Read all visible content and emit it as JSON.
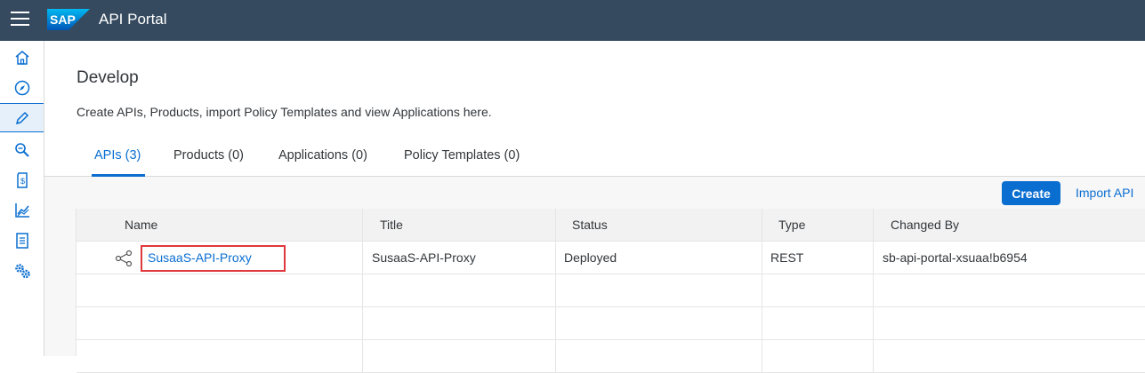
{
  "shell": {
    "title": "API Portal",
    "logo_text": "SAP"
  },
  "sidenav": {
    "items": [
      {
        "icon": "home-icon"
      },
      {
        "icon": "compass-icon"
      },
      {
        "icon": "pencil-icon",
        "active": true
      },
      {
        "icon": "search-binoculars-icon"
      },
      {
        "icon": "product-document-icon"
      },
      {
        "icon": "line-chart-icon"
      },
      {
        "icon": "checklist-icon"
      },
      {
        "icon": "settings-gears-icon"
      }
    ]
  },
  "page": {
    "title": "Develop",
    "description": "Create APIs, Products, import Policy Templates and view Applications here."
  },
  "tabs": [
    {
      "label": "APIs (3)",
      "active": true
    },
    {
      "label": "Products (0)"
    },
    {
      "label": "Applications (0)"
    },
    {
      "label": "Policy Templates (0)"
    }
  ],
  "toolbar": {
    "create_label": "Create",
    "import_label": "Import API"
  },
  "table": {
    "columns": [
      "Name",
      "Title",
      "Status",
      "Type",
      "Changed By"
    ],
    "rows": [
      {
        "name": "SusaaS-API-Proxy",
        "title": "SusaaS-API-Proxy",
        "status": "Deployed",
        "type": "REST",
        "changed_by": "sb-api-portal-xsuaa!b6954"
      }
    ]
  },
  "colors": {
    "shell": "#354a5f",
    "accent": "#0a6ed1",
    "highlight_box": "#e0383c"
  }
}
